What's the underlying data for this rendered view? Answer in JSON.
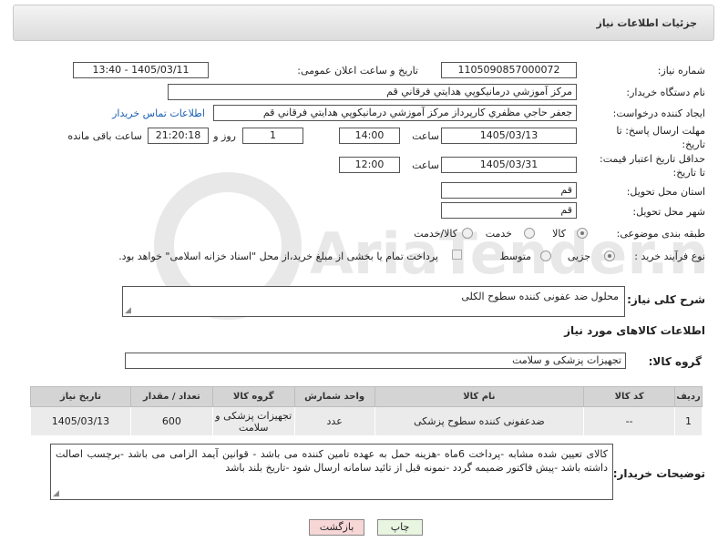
{
  "header": {
    "title": "جزئیات اطلاعات نیاز"
  },
  "fields": {
    "need_number_label": "شماره نیاز:",
    "need_number": "1105090857000072",
    "announce_label": "تاریخ و ساعت اعلان عمومی:",
    "announce_value": "1405/03/11 - 13:40",
    "buyer_label": "نام دستگاه خریدار:",
    "buyer": "مرکز آموزشي درمانيکوپي هدايتي فرقاني قم",
    "creator_label": "ایجاد کننده درخواست:",
    "creator": "جعفر حاجي مظفري کارپرداز مرکز آموزشي درمانيکوپي هدايتي فرقاني قم",
    "contact_link": "اطلاعات تماس خریدار",
    "deadline_label_1": "مهلت ارسال پاسخ: تا",
    "deadline_label_2": "تاریخ:",
    "deadline_date": "1405/03/13",
    "time_label": "ساعت",
    "deadline_time": "14:00",
    "days_value": "1",
    "days_label": "روز و",
    "remaining_time": "21:20:18",
    "remaining_label": "ساعت باقی مانده",
    "validity_label_1": "حداقل تاریخ اعتبار قیمت:",
    "validity_label_2": "تا تاریخ:",
    "validity_date": "1405/03/31",
    "validity_time": "12:00",
    "province_label": "استان محل تحویل:",
    "province": "قم",
    "city_label": "شهر محل تحویل:",
    "city": "قم",
    "category_label": "طبقه بندی موضوعی:",
    "category_options": [
      "کالا",
      "خدمت",
      "کالا/خدمت"
    ],
    "process_label": "نوع فرآیند خرید :",
    "process_options": [
      "جزیی",
      "متوسط"
    ],
    "payment_note": "پرداخت تمام یا بخشی از مبلغ خرید،از محل \"اسناد خزانه اسلامی\" خواهد بود.",
    "description_label": "شرح کلی نیاز:",
    "description": "محلول ضد عفونی کننده سطوح الکلی",
    "items_section": "اطلاعات کالاهای مورد نیاز",
    "group_label": "گروه کالا:",
    "group": "تجهیزات پزشکی و سلامت"
  },
  "table": {
    "headers": [
      "ردیف",
      "کد کالا",
      "نام کالا",
      "واحد شمارش",
      "گروه کالا",
      "تعداد / مقدار",
      "تاریخ نیاز"
    ],
    "rows": [
      [
        "1",
        "--",
        "ضدعفونی کننده سطوح پزشکی",
        "عدد",
        "تجهیزات پزشکی و سلامت",
        "600",
        "1405/03/13"
      ]
    ]
  },
  "buyer_notes_label": "توضیحات خریدار:",
  "buyer_notes": "کالای تعیین شده مشابه -پرداخت 6ماه -هزینه حمل به عهده تامین کننده می باشد - قوانین آیمد الزامی می باشد -برچسب اصالت داشته باشد -پیش فاکتور ضمیمه گردد -نمونه قبل از تائید سامانه ارسال شود -تاریخ بلند باشد",
  "buttons": {
    "print": "چاپ",
    "back": "بازگشت"
  },
  "watermark": "AriaTender.neT",
  "colors": {
    "link": "#1a5fb4",
    "back_button": "#f7d6d6",
    "print_button": "#e8f5e0"
  }
}
